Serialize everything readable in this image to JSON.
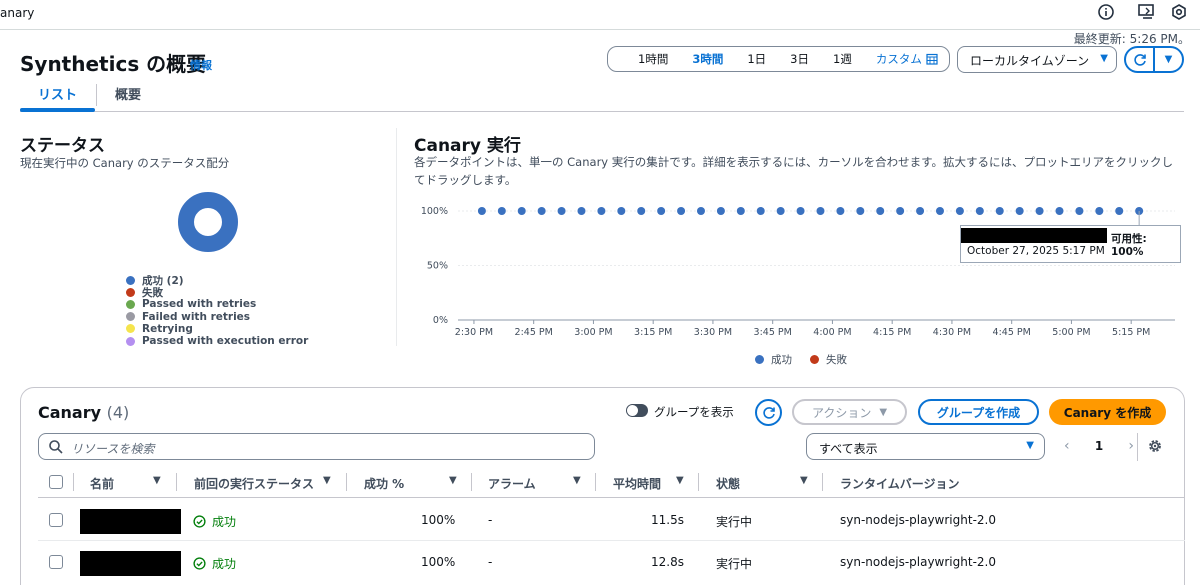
{
  "topbar": {
    "brand": "anary"
  },
  "header": {
    "last_updated": "最終更新: 5:26 PM。",
    "title": "Synthetics の概要",
    "info": "情報",
    "ranges": [
      "1時間",
      "3時間",
      "1日",
      "3日",
      "1週"
    ],
    "active_range": "3時間",
    "custom": "カスタム",
    "timezone": "ローカルタイムゾーン"
  },
  "tabs": [
    "リスト",
    "概要"
  ],
  "status": {
    "title": "ステータス",
    "subtitle": "現在実行中の Canary のステータス配分",
    "legend": [
      {
        "label": "成功 (2)",
        "color": "#3a71c0"
      },
      {
        "label": "失敗",
        "color": "#c23a1a"
      },
      {
        "label": "Passed with retries",
        "color": "#6aa84f"
      },
      {
        "label": "Failed with retries",
        "color": "#9a9aa3"
      },
      {
        "label": "Retrying",
        "color": "#f5e44d"
      },
      {
        "label": "Passed with execution error",
        "color": "#b48ff0"
      }
    ]
  },
  "runs": {
    "title": "Canary 実行",
    "description": "各データポイントは、単一の Canary 実行の集計です。詳細を表示するには、カーソルを合わせます。拡大するには、プロットエリアをクリックしてドラッグします。",
    "tooltip_avail": "可用性: 100%",
    "tooltip_date": "October 27, 2025 5:17 PM",
    "legend": [
      {
        "label": "成功",
        "color": "#3a71c0"
      },
      {
        "label": "失敗",
        "color": "#c23a1a"
      }
    ]
  },
  "chart_data": {
    "type": "scatter",
    "title": "Canary 実行",
    "xlabel": "",
    "ylabel": "",
    "y_ticks": [
      "100%",
      "50%",
      "0%"
    ],
    "x_ticks": [
      "2:30 PM",
      "2:45 PM",
      "3:00 PM",
      "3:15 PM",
      "3:30 PM",
      "3:45 PM",
      "4:00 PM",
      "4:15 PM",
      "4:30 PM",
      "4:45 PM",
      "5:00 PM",
      "5:15 PM"
    ],
    "ylim": [
      0,
      100
    ],
    "xlim": [
      "2:26 PM",
      "5:26 PM"
    ],
    "series": [
      {
        "name": "成功",
        "x": [
          "2:32 PM",
          "2:37 PM",
          "2:42 PM",
          "2:47 PM",
          "2:52 PM",
          "2:57 PM",
          "3:02 PM",
          "3:07 PM",
          "3:12 PM",
          "3:17 PM",
          "3:22 PM",
          "3:27 PM",
          "3:32 PM",
          "3:37 PM",
          "3:42 PM",
          "3:47 PM",
          "3:52 PM",
          "3:57 PM",
          "4:02 PM",
          "4:07 PM",
          "4:12 PM",
          "4:17 PM",
          "4:22 PM",
          "4:27 PM",
          "4:32 PM",
          "4:37 PM",
          "4:42 PM",
          "4:47 PM",
          "4:52 PM",
          "4:57 PM",
          "5:02 PM",
          "5:07 PM",
          "5:12 PM",
          "5:17 PM"
        ],
        "values": [
          100,
          100,
          100,
          100,
          100,
          100,
          100,
          100,
          100,
          100,
          100,
          100,
          100,
          100,
          100,
          100,
          100,
          100,
          100,
          100,
          100,
          100,
          100,
          100,
          100,
          100,
          100,
          100,
          100,
          100,
          100,
          100,
          100,
          100
        ]
      }
    ]
  },
  "table": {
    "title": "Canary",
    "count": "(4)",
    "group_toggle": "グループを表示",
    "actions": "アクション",
    "create_group": "グループを作成",
    "create_canary": "Canary を作成",
    "search_placeholder": "リソースを検索",
    "filter": "すべて表示",
    "page": "1",
    "columns": [
      "名前",
      "前回の実行ステータス",
      "成功 %",
      "アラーム",
      "平均時間",
      "状態",
      "ランタイムバージョン"
    ],
    "rows": [
      {
        "status": "成功",
        "success": "100%",
        "alarm": "-",
        "avg": "11.5s",
        "state": "実行中",
        "runtime": "syn-nodejs-playwright-2.0"
      },
      {
        "status": "成功",
        "success": "100%",
        "alarm": "-",
        "avg": "12.8s",
        "state": "実行中",
        "runtime": "syn-nodejs-playwright-2.0"
      }
    ]
  }
}
